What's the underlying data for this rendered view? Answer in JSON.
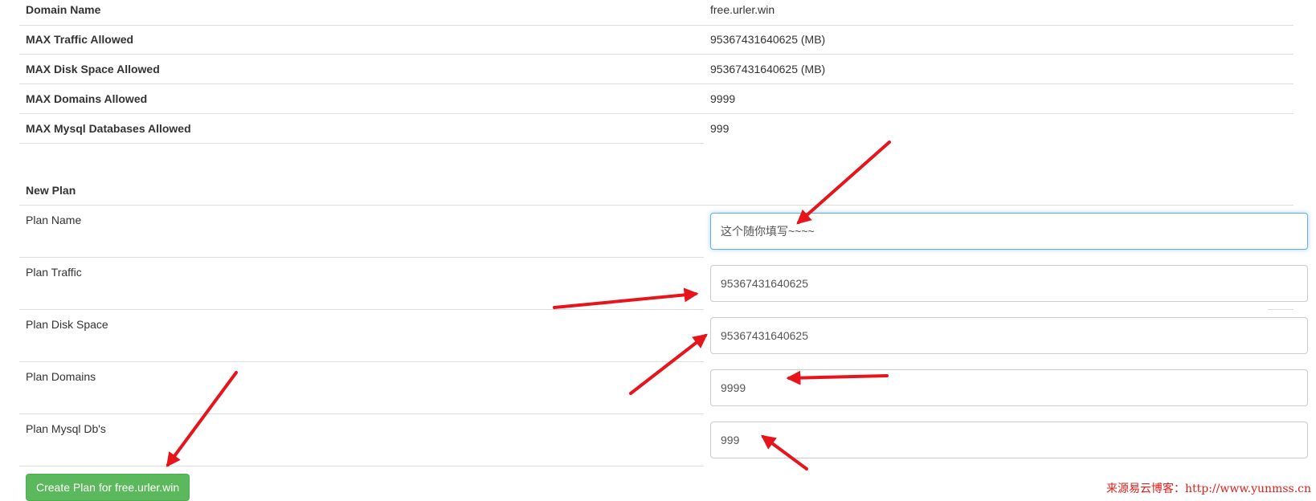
{
  "info_table": [
    {
      "label": "Domain Name",
      "value": "free.urler.win"
    },
    {
      "label": "MAX Traffic Allowed",
      "value": "95367431640625 (MB)"
    },
    {
      "label": "MAX Disk Space Allowed",
      "value": "95367431640625 (MB)"
    },
    {
      "label": "MAX Domains Allowed",
      "value": "9999"
    },
    {
      "label": "MAX Mysql Databases Allowed",
      "value": "999"
    }
  ],
  "new_plan": {
    "heading": "New Plan",
    "fields": [
      {
        "label": "Plan Name",
        "value": "这个随你填写~~~~"
      },
      {
        "label": "Plan Traffic",
        "value": "95367431640625"
      },
      {
        "label": "Plan Disk Space",
        "value": "95367431640625"
      },
      {
        "label": "Plan Domains",
        "value": "9999"
      },
      {
        "label": "Plan Mysql Db's",
        "value": "999"
      }
    ],
    "submit_label": "Create Plan for free.urler.win"
  },
  "watermark": "来源易云博客：http://www.yunmss.cn",
  "colors": {
    "arrow": "#e8141b",
    "button": "#5cb85c",
    "focus_border": "#66afe9"
  }
}
